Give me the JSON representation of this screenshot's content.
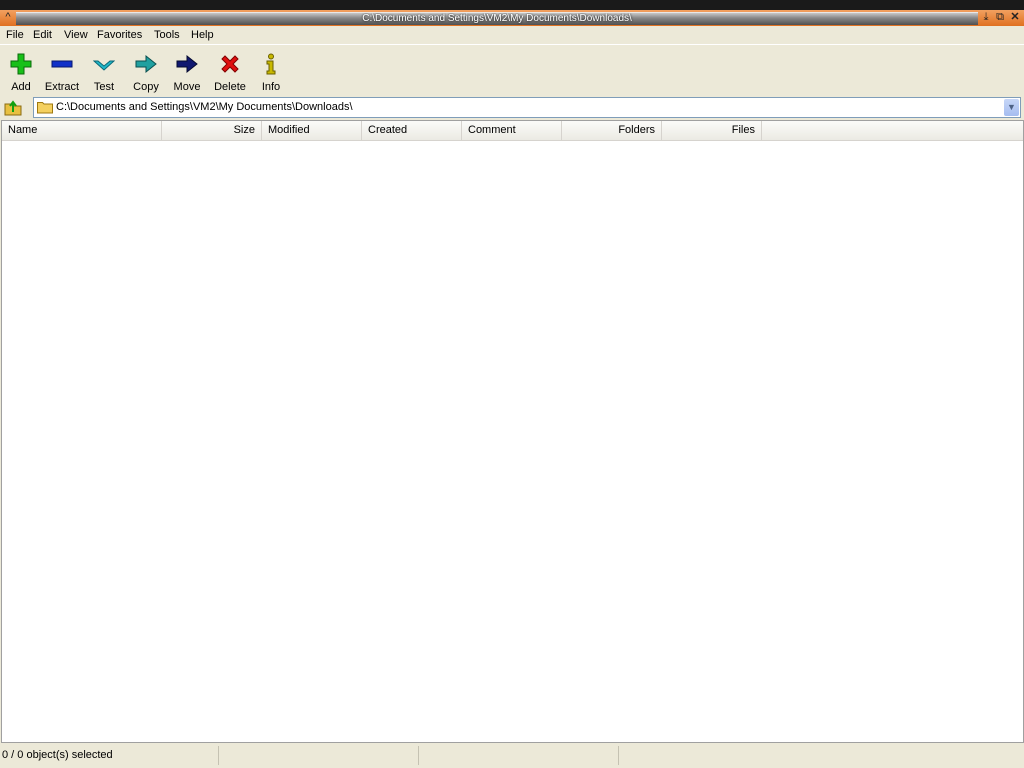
{
  "window": {
    "title": "C:\\Documents and Settings\\VM2\\My Documents\\Downloads\\"
  },
  "menu": [
    {
      "label": "File"
    },
    {
      "label": "Edit"
    },
    {
      "label": "View"
    },
    {
      "label": "Favorites"
    },
    {
      "label": "Tools"
    },
    {
      "label": "Help"
    }
  ],
  "toolbar": {
    "add": "Add",
    "extract": "Extract",
    "test": "Test",
    "copy": "Copy",
    "move": "Move",
    "delete": "Delete",
    "info": "Info"
  },
  "address": {
    "path": "C:\\Documents and Settings\\VM2\\My Documents\\Downloads\\"
  },
  "columns": [
    {
      "label": "Name"
    },
    {
      "label": "Size"
    },
    {
      "label": "Modified"
    },
    {
      "label": "Created"
    },
    {
      "label": "Comment"
    },
    {
      "label": "Folders"
    },
    {
      "label": "Files"
    }
  ],
  "status": {
    "selection": "0 / 0 object(s) selected",
    "cell2": "",
    "cell3": ""
  },
  "colors": {
    "add": "#18c018",
    "extract": "#1030c8",
    "test": "#20b8c8",
    "copy": "#20a0a0",
    "move": "#101870",
    "delete": "#e01010",
    "info": "#c8b800"
  }
}
